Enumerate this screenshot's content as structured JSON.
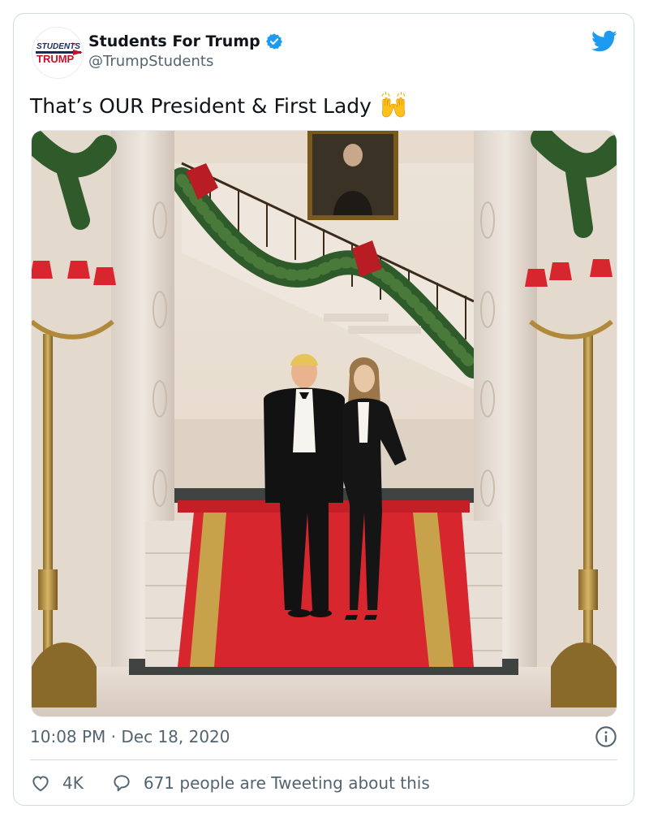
{
  "tweet": {
    "display_name": "Students For Trump",
    "handle": "@TrumpStudents",
    "text": "That’s OUR President & First Lady",
    "text_emoji": "raising-hands-emoji",
    "timestamp": "10:08 PM · Dec 18, 2020",
    "like_count": "4K",
    "retweet_text": "671 people are Tweeting about this"
  },
  "avatar": {
    "line1": "STUDENTS",
    "line1_small": "for",
    "line2": "TRUMP"
  },
  "icons": {
    "verified": "verified-badge-icon",
    "brand": "twitter-bird-icon",
    "info": "info-icon",
    "like": "heart-icon",
    "reply": "speech-bubble-icon"
  },
  "colors": {
    "accent": "#1d9bf0",
    "text_secondary": "#536471",
    "carpet": "#d8262e",
    "border": "#cfd9de"
  }
}
